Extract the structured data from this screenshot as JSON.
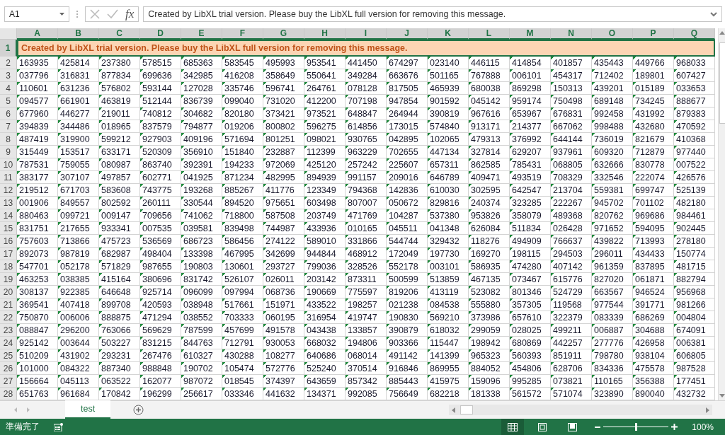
{
  "name_box": {
    "value": "A1"
  },
  "formula_bar": {
    "fx": "fx",
    "value": "Created by LibXL trial version. Please buy the LibXL full version for removing this message."
  },
  "columns": [
    {
      "label": "A",
      "selected": true
    },
    {
      "label": "B",
      "selected": true
    },
    {
      "label": "C",
      "selected": true
    },
    {
      "label": "D",
      "selected": true
    },
    {
      "label": "E",
      "selected": true
    },
    {
      "label": "F",
      "selected": true
    },
    {
      "label": "G",
      "selected": true
    },
    {
      "label": "H",
      "selected": true
    },
    {
      "label": "I",
      "selected": true
    },
    {
      "label": "J",
      "selected": true
    },
    {
      "label": "K",
      "selected": true
    },
    {
      "label": "L",
      "selected": true
    },
    {
      "label": "M",
      "selected": true
    },
    {
      "label": "N",
      "selected": true
    },
    {
      "label": "O",
      "selected": true
    },
    {
      "label": "P",
      "selected": true
    },
    {
      "label": "Q",
      "selected": true
    }
  ],
  "rows": [
    {
      "header": "1",
      "selected": true,
      "kind": "banner",
      "text": "Created by LibXL trial version. Please buy the LibXL full version for removing this message."
    },
    {
      "header": "2",
      "selected": false,
      "kind": "data",
      "cells": [
        "163935",
        "425814",
        "237380",
        "578515",
        "685363",
        "583545",
        "495993",
        "953541",
        "441450",
        "674297",
        "023140",
        "446115",
        "414854",
        "401857",
        "435443",
        "449766",
        "968033"
      ]
    },
    {
      "header": "3",
      "selected": false,
      "kind": "data",
      "cells": [
        "037796",
        "316831",
        "877834",
        "699636",
        "342985",
        "416208",
        "358649",
        "550641",
        "349284",
        "663676",
        "501165",
        "767888",
        "006101",
        "454317",
        "712402",
        "189801",
        "607427"
      ]
    },
    {
      "header": "4",
      "selected": false,
      "kind": "data",
      "cells": [
        "110601",
        "631236",
        "576802",
        "593144",
        "127028",
        "335746",
        "596741",
        "264761",
        "078128",
        "817505",
        "465939",
        "680038",
        "869298",
        "150313",
        "439201",
        "015189",
        "033653"
      ]
    },
    {
      "header": "5",
      "selected": false,
      "kind": "data",
      "cells": [
        "094577",
        "661901",
        "463819",
        "512144",
        "836739",
        "099040",
        "731020",
        "412200",
        "707198",
        "947854",
        "901592",
        "045142",
        "959174",
        "750498",
        "689148",
        "734245",
        "888677"
      ]
    },
    {
      "header": "6",
      "selected": false,
      "kind": "data",
      "cells": [
        "677960",
        "446277",
        "219011",
        "740812",
        "304682",
        "820180",
        "373421",
        "973521",
        "648847",
        "264944",
        "390819",
        "967616",
        "653967",
        "676831",
        "992458",
        "431992",
        "879383"
      ]
    },
    {
      "header": "7",
      "selected": false,
      "kind": "data",
      "cells": [
        "394839",
        "344486",
        "018965",
        "837579",
        "794877",
        "019206",
        "800802",
        "596275",
        "614856",
        "173015",
        "574840",
        "913171",
        "214377",
        "667062",
        "998488",
        "432680",
        "470592"
      ]
    },
    {
      "header": "8",
      "selected": false,
      "kind": "data",
      "cells": [
        "487419",
        "319900",
        "599212",
        "927903",
        "409196",
        "571694",
        "801251",
        "098021",
        "930765",
        "042895",
        "102065",
        "479313",
        "376992",
        "644144",
        "736019",
        "821679",
        "410368"
      ]
    },
    {
      "header": "9",
      "selected": false,
      "kind": "data",
      "cells": [
        "315449",
        "153517",
        "633171",
        "520309",
        "356910",
        "151840",
        "232887",
        "112399",
        "963229",
        "702655",
        "447134",
        "327814",
        "629207",
        "937961",
        "609320",
        "712879",
        "977440"
      ]
    },
    {
      "header": "10",
      "selected": false,
      "kind": "data",
      "cells": [
        "787531",
        "759055",
        "080987",
        "863740",
        "392391",
        "194233",
        "972069",
        "425120",
        "257242",
        "225607",
        "657311",
        "862585",
        "785431",
        "068805",
        "632666",
        "830778",
        "007522"
      ]
    },
    {
      "header": "11",
      "selected": false,
      "kind": "data",
      "cells": [
        "383177",
        "307107",
        "497857",
        "602771",
        "041925",
        "871234",
        "482995",
        "894939",
        "991157",
        "209016",
        "646789",
        "409471",
        "493519",
        "708329",
        "332546",
        "222074",
        "426576"
      ]
    },
    {
      "header": "12",
      "selected": false,
      "kind": "data",
      "cells": [
        "219512",
        "671703",
        "583608",
        "743775",
        "193268",
        "885267",
        "411776",
        "123349",
        "794368",
        "142836",
        "610030",
        "302595",
        "642547",
        "213704",
        "559381",
        "699747",
        "525139"
      ]
    },
    {
      "header": "13",
      "selected": false,
      "kind": "data",
      "cells": [
        "001906",
        "849557",
        "802592",
        "260111",
        "330544",
        "894520",
        "975651",
        "603498",
        "807007",
        "050672",
        "829816",
        "240374",
        "323285",
        "222267",
        "945702",
        "701102",
        "482180"
      ]
    },
    {
      "header": "14",
      "selected": false,
      "kind": "data",
      "cells": [
        "880463",
        "099721",
        "009147",
        "709656",
        "741062",
        "718800",
        "587508",
        "203749",
        "471769",
        "104287",
        "537380",
        "953826",
        "358079",
        "489368",
        "820762",
        "969686",
        "984461"
      ]
    },
    {
      "header": "15",
      "selected": false,
      "kind": "data",
      "cells": [
        "831751",
        "217655",
        "933341",
        "007535",
        "039581",
        "839498",
        "744987",
        "433936",
        "010165",
        "045511",
        "041348",
        "626084",
        "511834",
        "026428",
        "971652",
        "594095",
        "902445"
      ]
    },
    {
      "header": "16",
      "selected": false,
      "kind": "data",
      "cells": [
        "757603",
        "713866",
        "475723",
        "536569",
        "686723",
        "586456",
        "274122",
        "589010",
        "331866",
        "544744",
        "329432",
        "118276",
        "494909",
        "766637",
        "439822",
        "713993",
        "278180"
      ]
    },
    {
      "header": "17",
      "selected": false,
      "kind": "data",
      "cells": [
        "892073",
        "987819",
        "682987",
        "498404",
        "133398",
        "467995",
        "342699",
        "944844",
        "468912",
        "172049",
        "197730",
        "169270",
        "198115",
        "294503",
        "296011",
        "434433",
        "150774"
      ]
    },
    {
      "header": "18",
      "selected": false,
      "kind": "data",
      "cells": [
        "547701",
        "052178",
        "571829",
        "987655",
        "190803",
        "130601",
        "293727",
        "799036",
        "328526",
        "552178",
        "003101",
        "586935",
        "474280",
        "407142",
        "961359",
        "837895",
        "481715"
      ]
    },
    {
      "header": "19",
      "selected": false,
      "kind": "data",
      "cells": [
        "463253",
        "038385",
        "415164",
        "380696",
        "831742",
        "526107",
        "026011",
        "203142",
        "873311",
        "500599",
        "513859",
        "467135",
        "073467",
        "615776",
        "827020",
        "061871",
        "882794"
      ]
    },
    {
      "header": "20",
      "selected": false,
      "kind": "data",
      "cells": [
        "308137",
        "922385",
        "646648",
        "925714",
        "096099",
        "097994",
        "068736",
        "190669",
        "775597",
        "819206",
        "413119",
        "523082",
        "801346",
        "524729",
        "663567",
        "946524",
        "956968"
      ]
    },
    {
      "header": "21",
      "selected": false,
      "kind": "data",
      "cells": [
        "369541",
        "407418",
        "899708",
        "420593",
        "038948",
        "517661",
        "151971",
        "433522",
        "198257",
        "021238",
        "084538",
        "555880",
        "357305",
        "119568",
        "977544",
        "391771",
        "981266"
      ]
    },
    {
      "header": "22",
      "selected": false,
      "kind": "data",
      "cells": [
        "750870",
        "006006",
        "888875",
        "471294",
        "038552",
        "703333",
        "060195",
        "316954",
        "419747",
        "190830",
        "569210",
        "373986",
        "657610",
        "322379",
        "083339",
        "686269",
        "004804"
      ]
    },
    {
      "header": "23",
      "selected": false,
      "kind": "data",
      "cells": [
        "088847",
        "296200",
        "763066",
        "569629",
        "787599",
        "457699",
        "491578",
        "043438",
        "133857",
        "390879",
        "618032",
        "299059",
        "028025",
        "499211",
        "006887",
        "304688",
        "674091"
      ]
    },
    {
      "header": "24",
      "selected": false,
      "kind": "data",
      "cells": [
        "925142",
        "003644",
        "503227",
        "831215",
        "844763",
        "712791",
        "930053",
        "668032",
        "194806",
        "903366",
        "115447",
        "198942",
        "680869",
        "442257",
        "277776",
        "426958",
        "006381"
      ]
    },
    {
      "header": "25",
      "selected": false,
      "kind": "data",
      "cells": [
        "510209",
        "431902",
        "293231",
        "267476",
        "610327",
        "430288",
        "108277",
        "640686",
        "068014",
        "491142",
        "141399",
        "965323",
        "560393",
        "851911",
        "798780",
        "938104",
        "606805"
      ]
    },
    {
      "header": "26",
      "selected": false,
      "kind": "data",
      "cells": [
        "101000",
        "084322",
        "887340",
        "988848",
        "190702",
        "105474",
        "572776",
        "525240",
        "370514",
        "916846",
        "869955",
        "884052",
        "454806",
        "628706",
        "834336",
        "475578",
        "987528"
      ]
    },
    {
      "header": "27",
      "selected": false,
      "kind": "data",
      "cells": [
        "156664",
        "045113",
        "063522",
        "162077",
        "987072",
        "018545",
        "374397",
        "643659",
        "857342",
        "885443",
        "415975",
        "159096",
        "995285",
        "073821",
        "110165",
        "356388",
        "177451"
      ]
    },
    {
      "header": "28",
      "selected": false,
      "kind": "data",
      "cells": [
        "651763",
        "961684",
        "170842",
        "196299",
        "256617",
        "033346",
        "441632",
        "134371",
        "992085",
        "756649",
        "682218",
        "181338",
        "561572",
        "571074",
        "323890",
        "890040",
        "432732"
      ]
    }
  ],
  "sheet_tabs": [
    {
      "label": "test",
      "selected": true
    }
  ],
  "status_bar": {
    "status": "準備完了",
    "views": [
      {
        "kind": "normal",
        "selected": true
      },
      {
        "kind": "page-layout",
        "selected": false
      },
      {
        "kind": "page-break",
        "selected": false
      }
    ],
    "zoom": {
      "level": 0.5,
      "reading": "100%"
    }
  }
}
